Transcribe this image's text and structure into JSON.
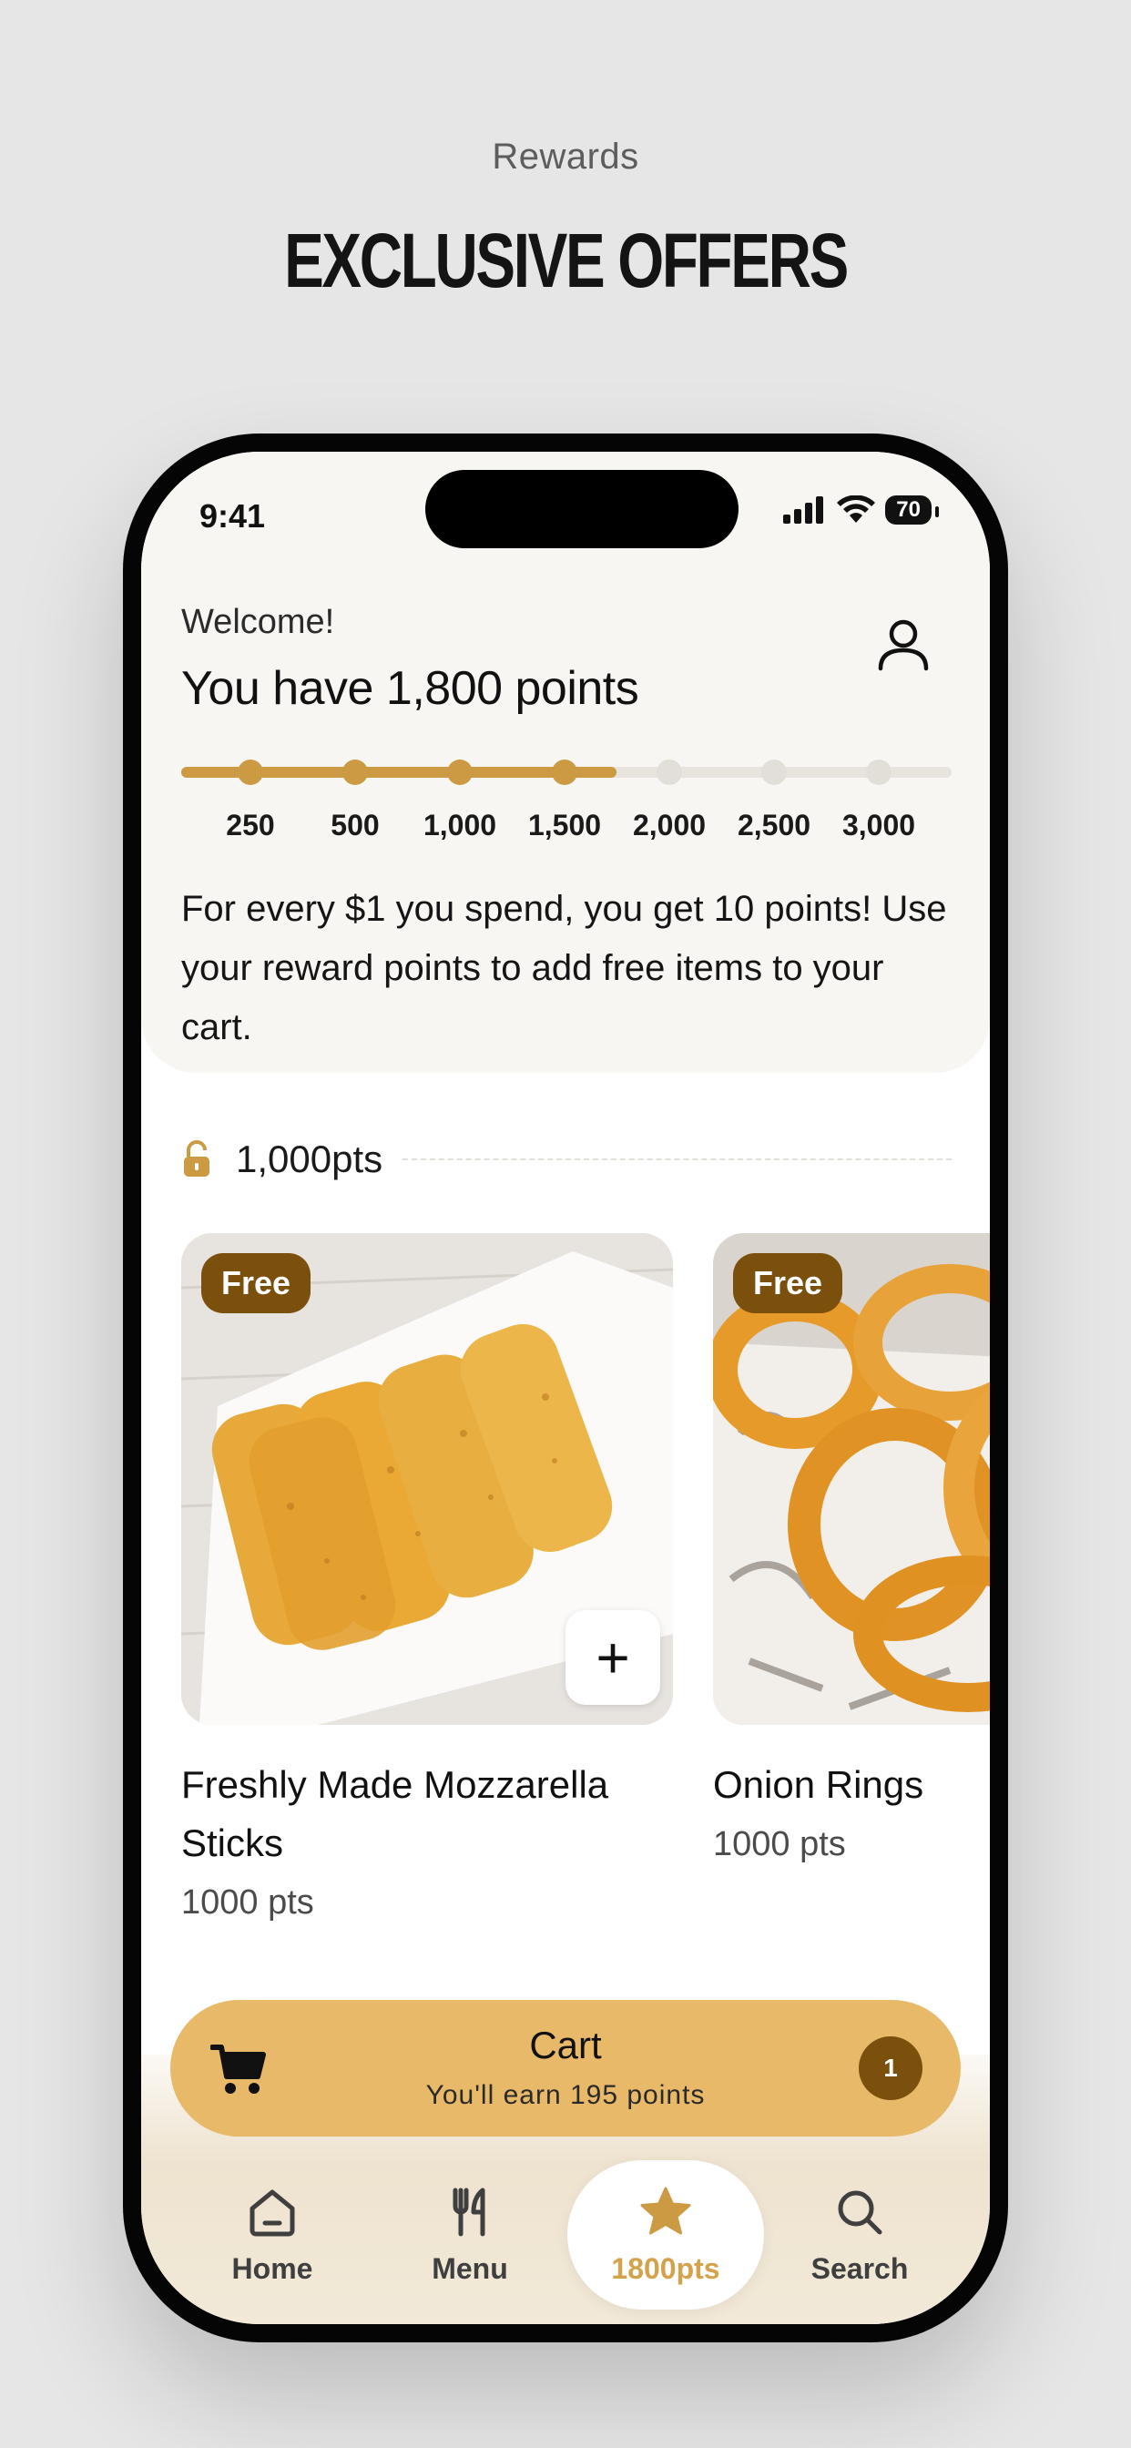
{
  "page": {
    "eyebrow": "Rewards",
    "heading": "EXCLUSIVE OFFERS"
  },
  "status_bar": {
    "time": "9:41",
    "battery": "70"
  },
  "header": {
    "welcome": "Welcome!",
    "points_title": "You have 1,800 points",
    "info": "For every $1 you spend, you get 10 points! Use your reward points to add free items to your cart."
  },
  "progress": {
    "current_points": 1800,
    "milestones": [
      "250",
      "500",
      "1,000",
      "1,500",
      "2,000",
      "2,500",
      "3,000"
    ],
    "achieved_count": 4,
    "fill_fraction": 0.565,
    "active_color": "#cb9a43",
    "inactive_color": "#e2ded8"
  },
  "tier": {
    "label": "1,000pts"
  },
  "items": [
    {
      "name": "Freshly Made Mozzarella Sticks",
      "points": "1000 pts",
      "badge": "Free",
      "add_label": "+"
    },
    {
      "name": "Onion Rings",
      "points": "1000 pts",
      "badge": "Free"
    }
  ],
  "cart": {
    "title": "Cart",
    "subtitle": "You'll earn 195 points",
    "count": "1"
  },
  "tabs": [
    {
      "label": "Home",
      "icon": "home-icon"
    },
    {
      "label": "Menu",
      "icon": "utensils-icon"
    },
    {
      "label": "1800pts",
      "icon": "star-icon",
      "active": true
    },
    {
      "label": "Search",
      "icon": "search-icon"
    }
  ],
  "colors": {
    "brand_gold": "#cb9a43",
    "badge_brown": "#7b4f0c",
    "cart_bar": "#e9b96a"
  }
}
